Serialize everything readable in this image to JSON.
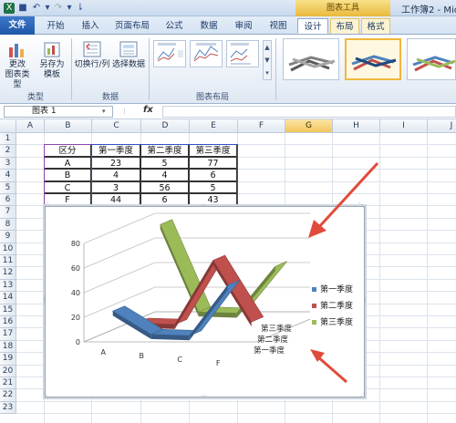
{
  "titlebar": {
    "context_tools": "图表工具",
    "doc_title": "工作簿2 - Mic"
  },
  "tabs": {
    "file": "文件",
    "items": [
      "开始",
      "插入",
      "页面布局",
      "公式",
      "数据",
      "审阅",
      "视图"
    ],
    "context": [
      "设计",
      "布局",
      "格式"
    ]
  },
  "ribbon": {
    "type_group": {
      "label": "类型",
      "change_chart_type": "更改\n图表类型",
      "save_as_template": "另存为\n模板"
    },
    "data_group": {
      "label": "数据",
      "switch_row_col": "切换行/列",
      "select_data": "选择数据"
    },
    "layout_group": {
      "label": "图表布局"
    }
  },
  "formula_bar": {
    "name_box": "图表 1",
    "fx": "fx"
  },
  "grid": {
    "columns": [
      "A",
      "B",
      "C",
      "D",
      "E",
      "F",
      "G",
      "H",
      "I",
      "J"
    ],
    "selected_column": "G",
    "rows": [
      "1",
      "2",
      "3",
      "4",
      "5",
      "6",
      "7",
      "8",
      "9",
      "10",
      "11",
      "12",
      "13",
      "14",
      "15",
      "16",
      "17",
      "18",
      "19",
      "20",
      "21",
      "22",
      "23"
    ],
    "table": {
      "headers": [
        "区分",
        "第一季度",
        "第二季度",
        "第三季度"
      ],
      "rows": [
        [
          "A",
          "23",
          "5",
          "77"
        ],
        [
          "B",
          "4",
          "4",
          "6"
        ],
        [
          "C",
          "3",
          "56",
          "5"
        ],
        [
          "F",
          "44",
          "6",
          "43"
        ]
      ]
    }
  },
  "colors": {
    "series1": "#4f81bd",
    "series2": "#c0504d",
    "series3": "#9bbb59"
  },
  "chart_data": {
    "type": "line",
    "categories": [
      "A",
      "B",
      "C",
      "F"
    ],
    "series": [
      {
        "name": "第一季度",
        "values": [
          23,
          4,
          3,
          44
        ]
      },
      {
        "name": "第二季度",
        "values": [
          5,
          4,
          56,
          6
        ]
      },
      {
        "name": "第三季度",
        "values": [
          77,
          6,
          5,
          43
        ]
      }
    ],
    "yticks": [
      "0",
      "20",
      "40",
      "60",
      "80"
    ],
    "ylim": [
      0,
      80
    ],
    "depth_labels": [
      "第三季度",
      "第二季度",
      "第一季度"
    ],
    "legend": "right",
    "legend_items": [
      "第一季度",
      "第二季度",
      "第三季度"
    ]
  }
}
